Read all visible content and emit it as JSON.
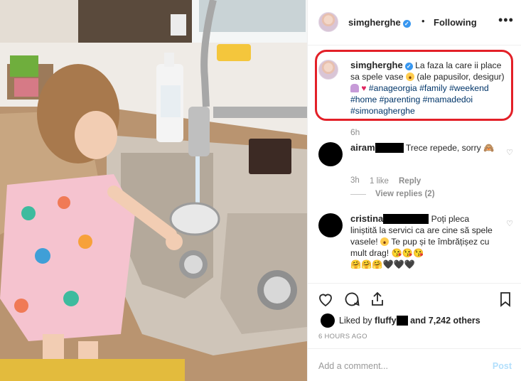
{
  "post": {
    "author": "simgherghe",
    "verified_mark": "✓",
    "dot": "•",
    "follow_status": "Following",
    "more_icon": "more-horizontal-icon",
    "more_text": "•••"
  },
  "caption": {
    "username": "simgherghe",
    "text_1": "La faza la care ii place sa spele vase",
    "text_2": "(ale papusilor, desigur)",
    "hashtags": [
      "#anageorgia",
      "#family",
      "#weekend",
      "#home",
      "#parenting",
      "#mamadedoi",
      "#simonagherghe"
    ],
    "time": "6h"
  },
  "comments": [
    {
      "username": "airam",
      "text": "Trece repede, sorry",
      "emoji": "🙈",
      "time": "3h",
      "likes": "1 like",
      "reply_label": "Reply",
      "view_replies": "View replies (2)"
    },
    {
      "username": "cristina",
      "text_1": "Poți pleca liniștită la servici ca are cine să spele vasele!",
      "text_2": "Te pup și te îmbrățișez cu mult drag!",
      "emojis_line": "😘😘😘",
      "emojis_line2": "🤗🤗🤗🖤🖤🖤"
    }
  ],
  "likes": {
    "prefix": "Liked by",
    "user": "fluffy",
    "suffix": "and 7,242 others"
  },
  "time_ago": "6 HOURS AGO",
  "add_comment": {
    "placeholder": "Add a comment...",
    "post_label": "Post"
  },
  "colors": {
    "highlight_border": "#e32028",
    "hashtag": "#003569",
    "verified": "#3897f0",
    "post_disabled": "#b2dffc"
  }
}
